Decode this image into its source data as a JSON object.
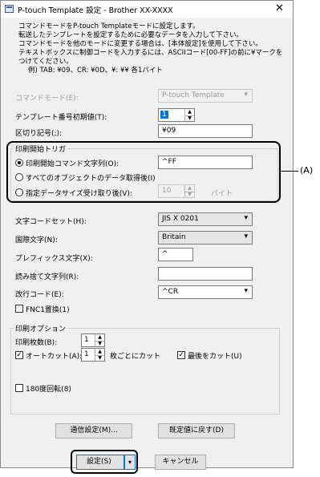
{
  "window": {
    "title": "P-touch Template 設定 - Brother  XX-XXXX",
    "close_glyph": "✕"
  },
  "description": {
    "line1": "コマンドモードをP-touch Templateモードに設定します。",
    "line2": "転送したテンプレートを設定するために必要なデータを入力して下さい。",
    "line3": "コマンドモードを他のモードに変更する場合は、[本体設定]を使用して下さい。",
    "line4": "テキストボックスに制御コードを入力するには、ASCIIコード[00-FF]の前に¥マークを",
    "line5": "つけてください。",
    "line6": "例) TAB: ¥09、CR: ¥0D、¥: ¥¥  各1バイト"
  },
  "command_mode": {
    "label": "コマンドモード(E):",
    "value": "P-touch Template"
  },
  "template_number": {
    "label": "テンプレート番号初期値(T):",
    "value": "1"
  },
  "delimiter": {
    "label": "区切り記号(;):",
    "value": "¥09"
  },
  "print_trigger": {
    "group_label": "印刷開始トリガ",
    "option1_label": "印刷開始コマンド文字列(O):",
    "option1_value": "^FF",
    "option2_label": "すべてのオブジェクトのデータ取得後(I)",
    "option3_label": "指定データサイズ受け取り後(V):",
    "option3_value": "10",
    "option3_unit": "バイト",
    "selected": "option1"
  },
  "callout": {
    "label": "(A)"
  },
  "char_code_set": {
    "label": "文字コードセット(H):",
    "value": "JIS X 0201"
  },
  "intl_chars": {
    "label": "国際文字(N):",
    "value": "Britain"
  },
  "prefix_char": {
    "label": "プレフィックス文字(X):",
    "value": "^"
  },
  "ignore_string": {
    "label": "読み捨て文字列(R):",
    "value": ""
  },
  "newline_code": {
    "label": "改行コード(E):",
    "value": "^CR"
  },
  "fnc1": {
    "label": "FNC1置換(1)",
    "checked": false
  },
  "print_options": {
    "group_label": "印刷オプション",
    "copies_label": "印刷枚数(B):",
    "copies_value": "1",
    "autocut_label": "オートカット(A):",
    "autocut_checked": true,
    "autocut_value": "1",
    "autocut_suffix": "枚ごとにカット",
    "cut_last_label": "最後をカット(U)",
    "cut_last_checked": true,
    "rotate_label": "180度回転(8)",
    "rotate_checked": false
  },
  "buttons": {
    "comm_settings": "通信設定(M)...",
    "reset_defaults": "既定値に戻す(D)",
    "set": "設定(S)",
    "cancel": "キャンセル"
  },
  "icons": {
    "dropdown": "▾",
    "spin_up": "▲",
    "spin_down": "▼",
    "check": "✓"
  }
}
